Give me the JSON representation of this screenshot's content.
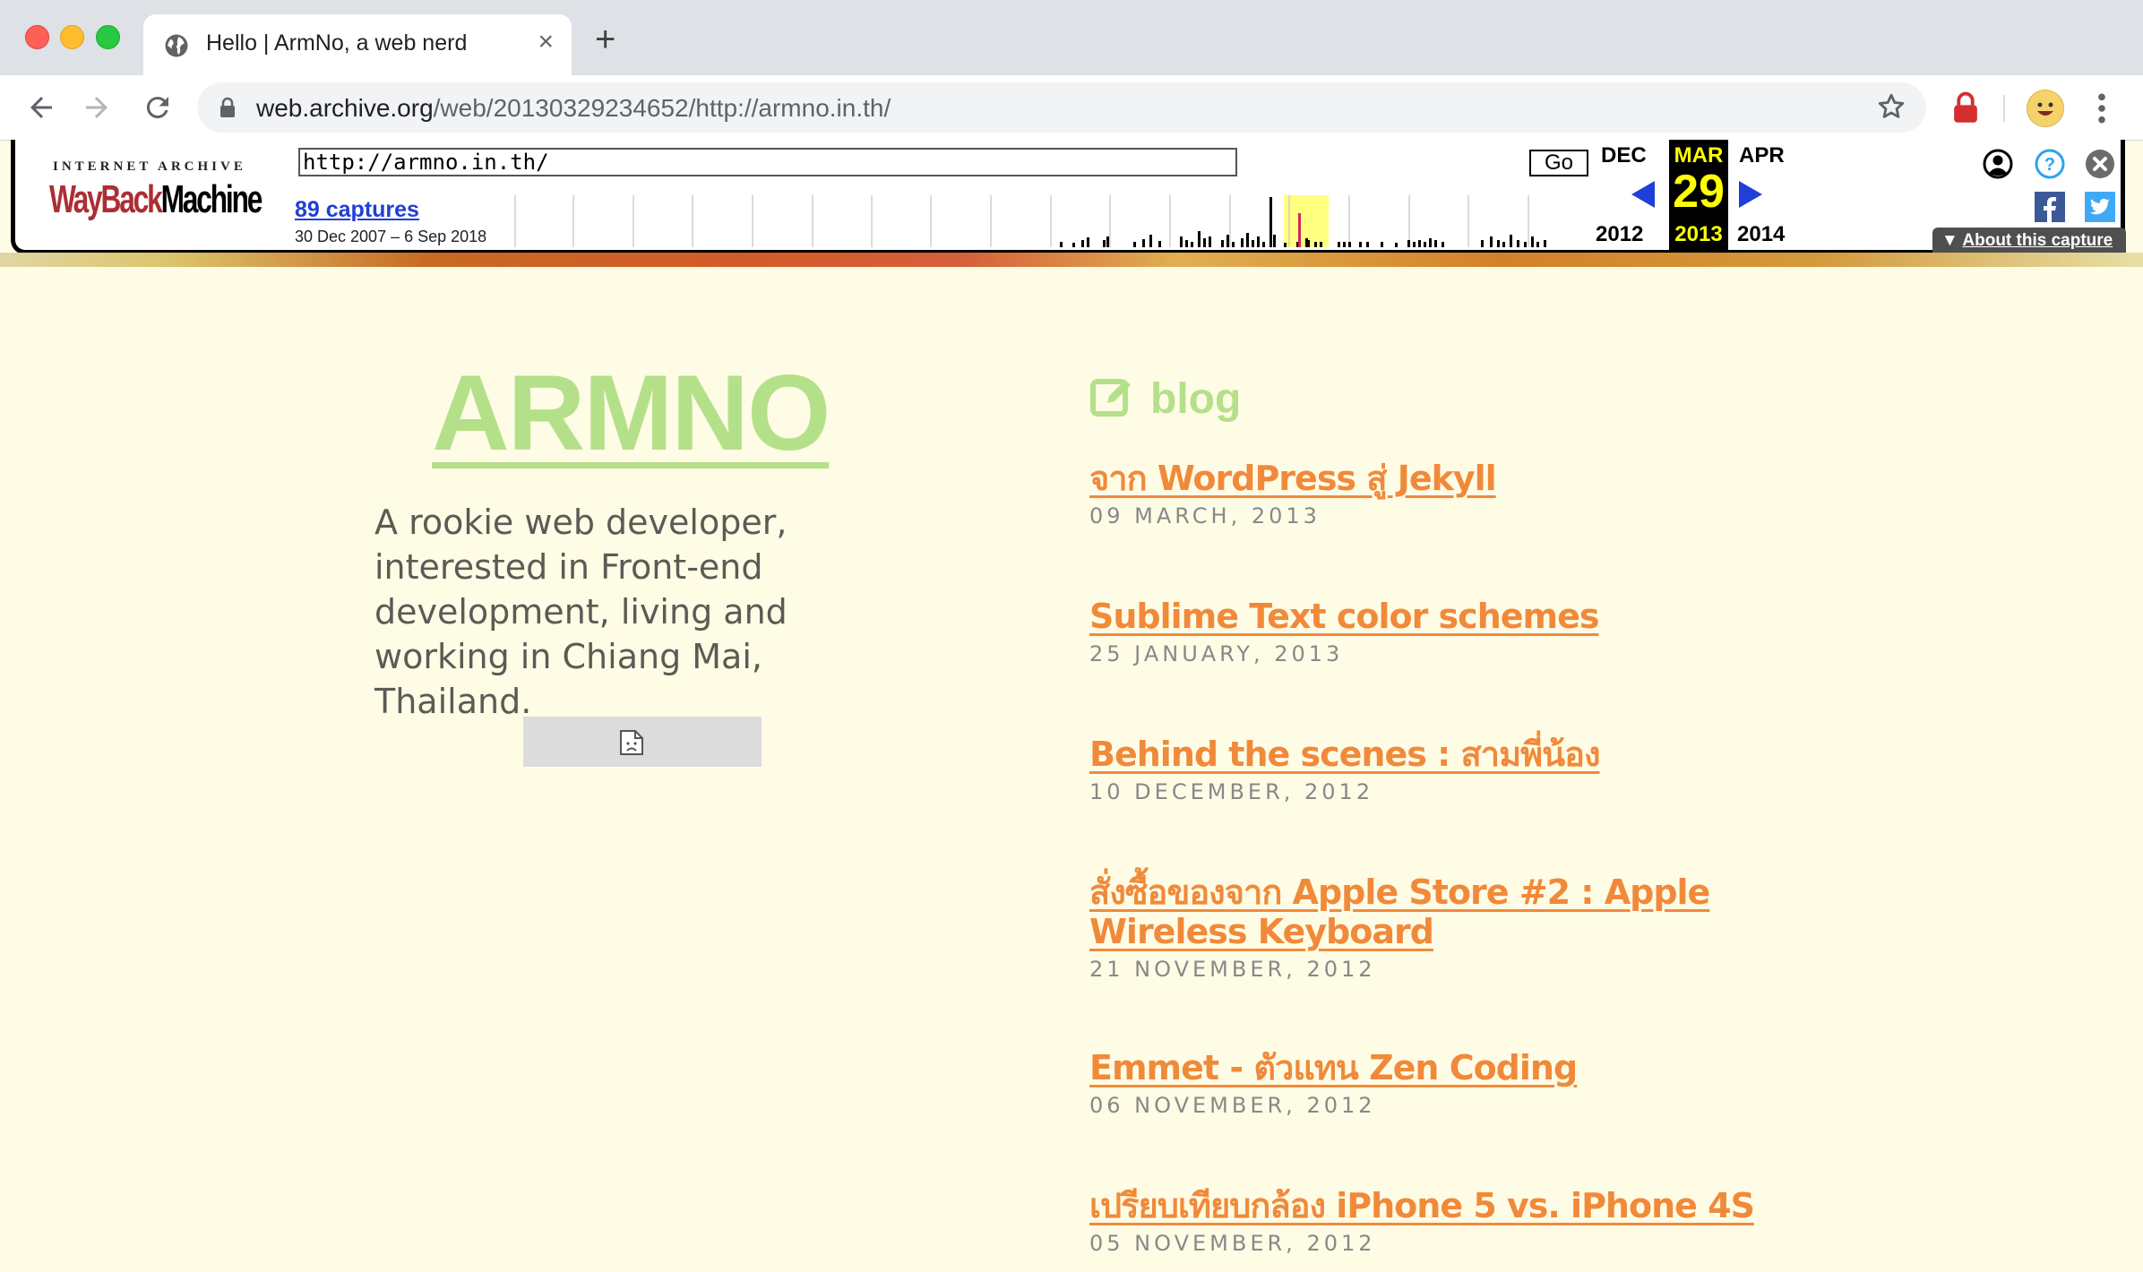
{
  "browser": {
    "tab_title": "Hello | ArmNo, a web nerd",
    "tab_close": "×",
    "new_tab": "+",
    "url_host": "web.archive.org",
    "url_path": "/web/20130329234652/http://armno.in.th/"
  },
  "wayback": {
    "logo_top": "INTERNET ARCHIVE",
    "logo_way": "WayBack",
    "logo_machine": "Machine",
    "url_value": "http://armno.in.th/",
    "go_label": "Go",
    "captures_label": "89 captures",
    "date_range": "30 Dec 2007 – 6 Sep 2018",
    "prev_month": "DEC",
    "prev_year": "2012",
    "cur_month": "MAR",
    "cur_day": "29",
    "cur_year": "2013",
    "next_month": "APR",
    "next_year": "2014",
    "about_label": "About this capture",
    "about_icon": "▼"
  },
  "site": {
    "brand": "ARMNO",
    "bio": "A rookie web developer, interested in Front-end development, living and working in Chiang Mai, Thailand.",
    "blog_heading": "blog",
    "posts": [
      {
        "title": "จาก WordPress สู่ Jekyll",
        "date": "09 MARCH, 2013"
      },
      {
        "title": "Sublime Text color schemes",
        "date": "25 JANUARY, 2013"
      },
      {
        "title": "Behind the scenes : สามพี่น้อง",
        "date": "10 DECEMBER, 2012"
      },
      {
        "title": "สั่งซื้อของจาก Apple Store #2 : Apple Wireless Keyboard",
        "date": "21 NOVEMBER, 2012"
      },
      {
        "title": "Emmet - ตัวแทน Zen Coding",
        "date": "06 NOVEMBER, 2012"
      },
      {
        "title": "เปรียบเทียบกล้อง iPhone 5 vs. iPhone 4S",
        "date": "05 NOVEMBER, 2012"
      }
    ]
  },
  "colors": {
    "brand_green": "#b5e08a",
    "post_orange": "#f08a3a",
    "page_bg": "#fffce6",
    "wayback_current": "#ffff00"
  }
}
